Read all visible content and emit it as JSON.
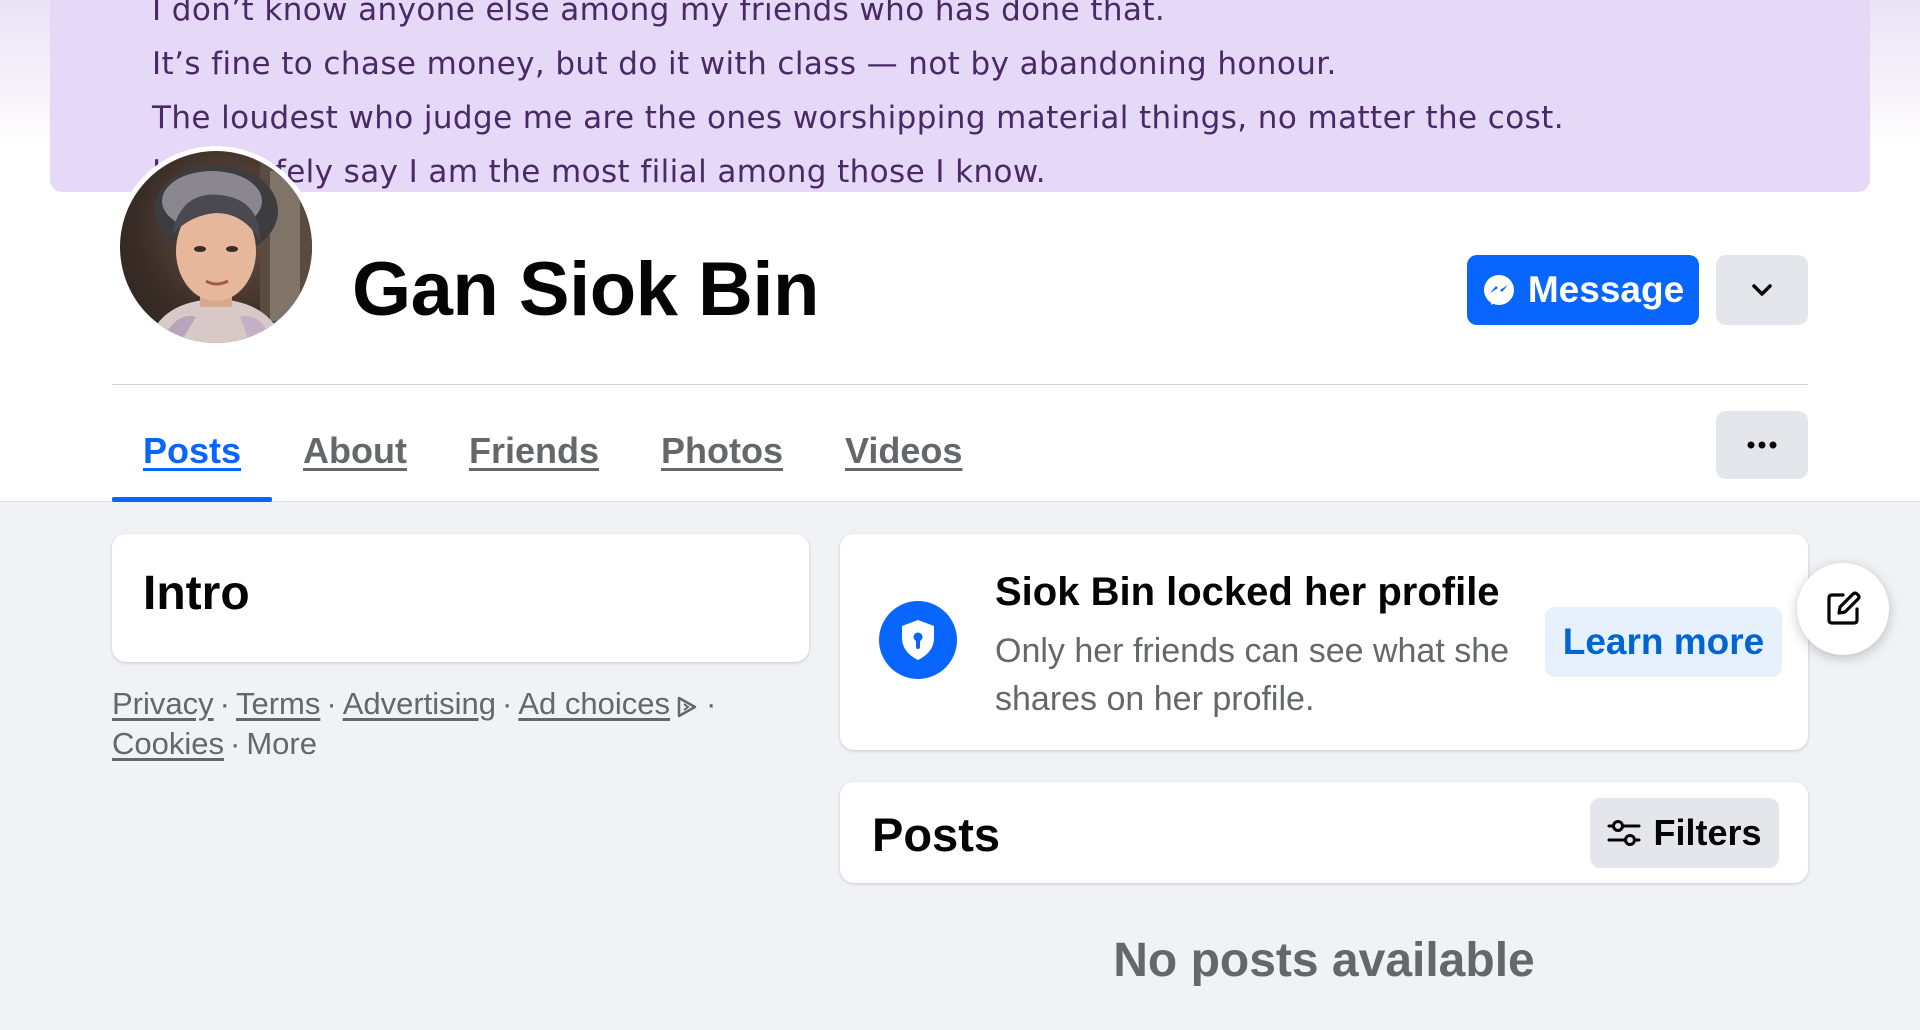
{
  "cover": {
    "lines": [
      "I don’t know anyone else among my friends who has done that.",
      "It’s fine to chase money, but do it with class — not by abandoning honour.",
      "The loudest who judge me are the ones worshipping material things, no matter the cost.",
      "I can safely say I am the most filial among those I know."
    ]
  },
  "profile": {
    "name": "Gan Siok Bin",
    "avatar_alt": "Profile picture"
  },
  "actions": {
    "message_label": "Message",
    "message_icon": "messenger-icon",
    "more_icon": "chevron-down-icon"
  },
  "tabs": [
    {
      "label": "Posts",
      "active": true
    },
    {
      "label": "About"
    },
    {
      "label": "Friends"
    },
    {
      "label": "Photos"
    },
    {
      "label": "Videos"
    }
  ],
  "tabs_more_icon": "more-dots-icon",
  "intro": {
    "title": "Intro"
  },
  "footer": {
    "privacy": "Privacy",
    "terms": "Terms",
    "advertising": "Advertising",
    "ad_choices": "Ad choices",
    "cookies": "Cookies",
    "more": "More"
  },
  "lock_notice": {
    "title": "Siok Bin locked her profile",
    "description": "Only her friends can see what she shares on her profile.",
    "learn_more": "Learn more",
    "icon": "shield-lock-icon"
  },
  "posts": {
    "title": "Posts",
    "filters_label": "Filters",
    "filters_icon": "filters-icon",
    "empty_message": "No posts available"
  },
  "colors": {
    "accent": "#0866ff",
    "cover_bg": "#e6d8f7",
    "page_bg": "#f0f2f5"
  }
}
